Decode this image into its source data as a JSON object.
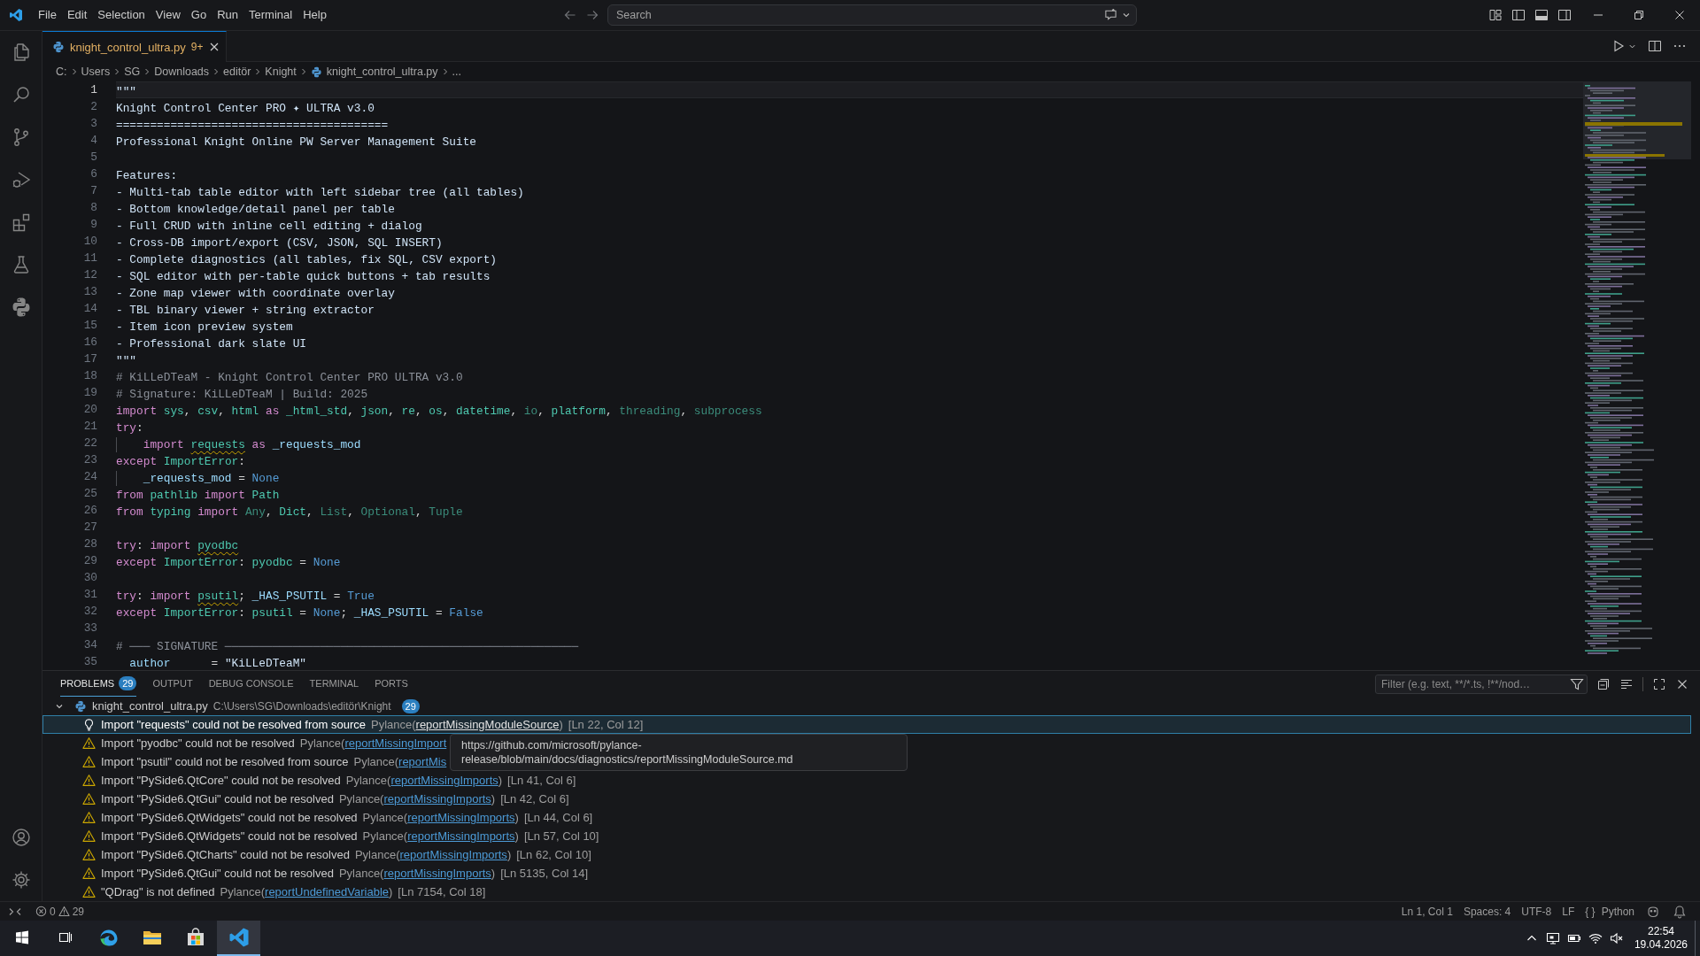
{
  "title_bar": {
    "menu": [
      "File",
      "Edit",
      "Selection",
      "View",
      "Go",
      "Run",
      "Terminal",
      "Help"
    ],
    "search": {
      "placeholder": "Search"
    }
  },
  "editor": {
    "tabs": [
      {
        "label": "knight_control_ultra.py",
        "badge": "9+",
        "selected": true
      }
    ],
    "breadcrumb": [
      {
        "label": "C:",
        "kind": "segment"
      },
      {
        "label": "Users",
        "kind": "segment"
      },
      {
        "label": "SG",
        "kind": "segment"
      },
      {
        "label": "Downloads",
        "kind": "segment"
      },
      {
        "label": "editör",
        "kind": "segment"
      },
      {
        "label": "Knight",
        "kind": "segment"
      },
      {
        "label": "knight_control_ultra.py",
        "kind": "file"
      },
      {
        "label": "...",
        "kind": "segment"
      }
    ],
    "lines": [
      {
        "n": "1",
        "current": true,
        "tokens": [
          {
            "t": "\"\"\"",
            "kind": "string"
          }
        ]
      },
      {
        "n": "2",
        "current": false,
        "tokens": [
          {
            "t": "Knight Control Center PRO ✦ ULTRA v3.0",
            "kind": "string"
          }
        ]
      },
      {
        "n": "3",
        "current": false,
        "tokens": [
          {
            "t": "========================================",
            "kind": "string"
          }
        ]
      },
      {
        "n": "4",
        "current": false,
        "tokens": [
          {
            "t": "Professional Knight Online PW Server Management Suite",
            "kind": "string"
          }
        ]
      },
      {
        "n": "5",
        "current": false
      },
      {
        "n": "6",
        "current": false,
        "tokens": [
          {
            "t": "Features:",
            "kind": "string"
          }
        ]
      },
      {
        "n": "7",
        "current": false,
        "tokens": [
          {
            "t": "- Multi-tab table editor with left sidebar tree (all tables)",
            "kind": "string"
          }
        ]
      },
      {
        "n": "8",
        "current": false,
        "tokens": [
          {
            "t": "- Bottom knowledge/detail panel per table",
            "kind": "string"
          }
        ]
      },
      {
        "n": "9",
        "current": false,
        "tokens": [
          {
            "t": "- Full CRUD with inline cell editing + dialog",
            "kind": "string"
          }
        ]
      },
      {
        "n": "10",
        "current": false,
        "tokens": [
          {
            "t": "- Cross-DB import/export (CSV, JSON, SQL INSERT)",
            "kind": "string"
          }
        ]
      },
      {
        "n": "11",
        "current": false,
        "tokens": [
          {
            "t": "- Complete diagnostics (all tables, fix SQL, CSV export)",
            "kind": "string"
          }
        ]
      },
      {
        "n": "12",
        "current": false,
        "tokens": [
          {
            "t": "- SQL editor with per-table quick buttons + tab results",
            "kind": "string"
          }
        ]
      },
      {
        "n": "13",
        "current": false,
        "tokens": [
          {
            "t": "- Zone map viewer with coordinate overlay",
            "kind": "string"
          }
        ]
      },
      {
        "n": "14",
        "current": false,
        "tokens": [
          {
            "t": "- TBL binary viewer + string extractor",
            "kind": "string"
          }
        ]
      },
      {
        "n": "15",
        "current": false,
        "tokens": [
          {
            "t": "- Item icon preview system",
            "kind": "string"
          }
        ]
      },
      {
        "n": "16",
        "current": false,
        "tokens": [
          {
            "t": "- Professional dark slate UI",
            "kind": "string"
          }
        ]
      },
      {
        "n": "17",
        "current": false,
        "tokens": [
          {
            "t": "\"\"\"",
            "kind": "string"
          }
        ]
      },
      {
        "n": "18",
        "current": false,
        "tokens": [
          {
            "t": "# KiLLeDTeaM - Knight Control Center PRO ULTRA v3.0",
            "kind": "comment"
          }
        ]
      },
      {
        "n": "19",
        "current": false,
        "tokens": [
          {
            "t": "# Signature: KiLLeDTeaM | Build: 2025",
            "kind": "comment"
          }
        ]
      },
      {
        "n": "20",
        "current": false,
        "tokens": [
          {
            "t": "import ",
            "kind": "keyword"
          },
          {
            "t": "sys",
            "kind": "module"
          },
          {
            "t": ", ",
            "kind": "plain"
          },
          {
            "t": "csv",
            "kind": "module"
          },
          {
            "t": ", ",
            "kind": "plain"
          },
          {
            "t": "html",
            "kind": "module"
          },
          {
            "t": " as ",
            "kind": "keyword"
          },
          {
            "t": "_html_std",
            "kind": "module"
          },
          {
            "t": ", ",
            "kind": "plain"
          },
          {
            "t": "json",
            "kind": "module"
          },
          {
            "t": ", ",
            "kind": "plain"
          },
          {
            "t": "re",
            "kind": "module"
          },
          {
            "t": ", ",
            "kind": "plain"
          },
          {
            "t": "os",
            "kind": "module"
          },
          {
            "t": ", ",
            "kind": "plain"
          },
          {
            "t": "datetime",
            "kind": "module"
          },
          {
            "t": ", ",
            "kind": "plain"
          },
          {
            "t": "io",
            "kind": "unused"
          },
          {
            "t": ", ",
            "kind": "plain"
          },
          {
            "t": "platform",
            "kind": "module"
          },
          {
            "t": ", ",
            "kind": "plain"
          },
          {
            "t": "threading",
            "kind": "unused"
          },
          {
            "t": ", ",
            "kind": "plain"
          },
          {
            "t": "subprocess",
            "kind": "unused"
          }
        ]
      },
      {
        "n": "21",
        "current": false,
        "tokens": [
          {
            "t": "try",
            "kind": "keyword"
          },
          {
            "t": ":",
            "kind": "plain"
          }
        ]
      },
      {
        "n": "22",
        "current": false,
        "indent_guide": true,
        "tokens": [
          {
            "t": "    import ",
            "kind": "keyword"
          },
          {
            "t": "requests",
            "kind": "unresolved"
          },
          {
            "t": " as ",
            "kind": "keyword"
          },
          {
            "t": "_requests_mod",
            "kind": "variable"
          }
        ]
      },
      {
        "n": "23",
        "current": false,
        "tokens": [
          {
            "t": "except ",
            "kind": "keyword"
          },
          {
            "t": "ImportError",
            "kind": "module"
          },
          {
            "t": ":",
            "kind": "plain"
          }
        ]
      },
      {
        "n": "24",
        "current": false,
        "indent_guide": true,
        "tokens": [
          {
            "t": "    _requests_mod",
            "kind": "variable"
          },
          {
            "t": " = ",
            "kind": "plain"
          },
          {
            "t": "None",
            "kind": "constant"
          }
        ]
      },
      {
        "n": "25",
        "current": false,
        "tokens": [
          {
            "t": "from ",
            "kind": "keyword"
          },
          {
            "t": "pathlib",
            "kind": "module"
          },
          {
            "t": " import ",
            "kind": "keyword"
          },
          {
            "t": "Path",
            "kind": "module"
          }
        ]
      },
      {
        "n": "26",
        "current": false,
        "tokens": [
          {
            "t": "from ",
            "kind": "keyword"
          },
          {
            "t": "typing",
            "kind": "module"
          },
          {
            "t": " import ",
            "kind": "keyword"
          },
          {
            "t": "Any",
            "kind": "unused"
          },
          {
            "t": ", ",
            "kind": "plain"
          },
          {
            "t": "Dict",
            "kind": "module"
          },
          {
            "t": ", ",
            "kind": "plain"
          },
          {
            "t": "List",
            "kind": "unused"
          },
          {
            "t": ", ",
            "kind": "plain"
          },
          {
            "t": "Optional",
            "kind": "unused"
          },
          {
            "t": ", ",
            "kind": "plain"
          },
          {
            "t": "Tuple",
            "kind": "unused"
          }
        ]
      },
      {
        "n": "27",
        "current": false
      },
      {
        "n": "28",
        "current": false,
        "tokens": [
          {
            "t": "try",
            "kind": "keyword"
          },
          {
            "t": ": ",
            "kind": "plain"
          },
          {
            "t": "import ",
            "kind": "keyword"
          },
          {
            "t": "pyodbc",
            "kind": "unresolved"
          }
        ]
      },
      {
        "n": "29",
        "current": false,
        "tokens": [
          {
            "t": "except ",
            "kind": "keyword"
          },
          {
            "t": "ImportError",
            "kind": "module"
          },
          {
            "t": ": ",
            "kind": "plain"
          },
          {
            "t": "pyodbc",
            "kind": "module"
          },
          {
            "t": " = ",
            "kind": "plain"
          },
          {
            "t": "None",
            "kind": "constant"
          }
        ]
      },
      {
        "n": "30",
        "current": false
      },
      {
        "n": "31",
        "current": false,
        "tokens": [
          {
            "t": "try",
            "kind": "keyword"
          },
          {
            "t": ": ",
            "kind": "plain"
          },
          {
            "t": "import ",
            "kind": "keyword"
          },
          {
            "t": "psutil",
            "kind": "unresolved"
          },
          {
            "t": "; ",
            "kind": "plain"
          },
          {
            "t": "_HAS_PSUTIL",
            "kind": "variable"
          },
          {
            "t": " = ",
            "kind": "plain"
          },
          {
            "t": "True",
            "kind": "constant"
          }
        ]
      },
      {
        "n": "32",
        "current": false,
        "tokens": [
          {
            "t": "except ",
            "kind": "keyword"
          },
          {
            "t": "ImportError",
            "kind": "module"
          },
          {
            "t": ": ",
            "kind": "plain"
          },
          {
            "t": "psutil",
            "kind": "module"
          },
          {
            "t": " = ",
            "kind": "plain"
          },
          {
            "t": "None",
            "kind": "constant"
          },
          {
            "t": "; ",
            "kind": "plain"
          },
          {
            "t": "_HAS_PSUTIL",
            "kind": "variable"
          },
          {
            "t": " = ",
            "kind": "plain"
          },
          {
            "t": "False",
            "kind": "constant"
          }
        ]
      },
      {
        "n": "33",
        "current": false
      },
      {
        "n": "34",
        "current": false,
        "tokens": [
          {
            "t": "# ─── SIGNATURE ────────────────────────────────────────────────────",
            "kind": "comment"
          }
        ]
      },
      {
        "n": "35",
        "current": false,
        "tokens": [
          {
            "t": "  author",
            "kind": "variable"
          },
          {
            "t": "      = ",
            "kind": "plain"
          },
          {
            "t": "\"KiLLeDTeaM\"",
            "kind": "string"
          }
        ]
      }
    ]
  },
  "panel": {
    "tabs": [
      {
        "label": "PROBLEMS",
        "badge": "29",
        "selected": true
      },
      {
        "label": "OUTPUT",
        "selected": false
      },
      {
        "label": "DEBUG CONSOLE",
        "selected": false
      },
      {
        "label": "TERMINAL",
        "selected": false
      },
      {
        "label": "PORTS",
        "selected": false
      }
    ],
    "filter": {
      "placeholder": "Filter (e.g. text, **/*.ts, !**/nod…"
    },
    "problems": {
      "file": {
        "name": "knight_control_ultra.py",
        "path": "C:\\Users\\SG\\Downloads\\editör\\Knight",
        "count": "29",
        "expanded": true
      },
      "rows": [
        {
          "message": "Import \"requests\" could not be resolved from source",
          "source": "Pylance(",
          "code": "reportMissingModuleSource",
          "source_end": ")",
          "location": "[Ln 22, Col 12]",
          "selected": true
        },
        {
          "message": "Import \"pyodbc\" could not be resolved",
          "source": "Pylance(",
          "code": "reportMissingImport",
          "selected": false
        },
        {
          "message": "Import \"psutil\" could not be resolved from source",
          "source": "Pylance(",
          "code": "reportMis",
          "selected": false
        },
        {
          "message": "Import \"PySide6.QtCore\" could not be resolved",
          "source": "Pylance(",
          "code": "reportMissingImports",
          "source_end": ")",
          "location": "[Ln 41, Col 6]",
          "selected": false
        },
        {
          "message": "Import \"PySide6.QtGui\" could not be resolved",
          "source": "Pylance(",
          "code": "reportMissingImports",
          "source_end": ")",
          "location": "[Ln 42, Col 6]",
          "selected": false
        },
        {
          "message": "Import \"PySide6.QtWidgets\" could not be resolved",
          "source": "Pylance(",
          "code": "reportMissingImports",
          "source_end": ")",
          "location": "[Ln 44, Col 6]",
          "selected": false
        },
        {
          "message": "Import \"PySide6.QtWidgets\" could not be resolved",
          "source": "Pylance(",
          "code": "reportMissingImports",
          "source_end": ")",
          "location": "[Ln 57, Col 10]",
          "selected": false
        },
        {
          "message": "Import \"PySide6.QtCharts\" could not be resolved",
          "source": "Pylance(",
          "code": "reportMissingImports",
          "source_end": ")",
          "location": "[Ln 62, Col 10]",
          "selected": false
        },
        {
          "message": "Import \"PySide6.QtGui\" could not be resolved",
          "source": "Pylance(",
          "code": "reportMissingImports",
          "source_end": ")",
          "location": "[Ln 5135, Col 14]",
          "selected": false
        },
        {
          "message": "\"QDrag\" is not defined",
          "source": "Pylance(",
          "code": "reportUndefinedVariable",
          "source_end": ")",
          "location": "[Ln 7154, Col 18]",
          "selected": false
        }
      ]
    },
    "tooltip": {
      "lines": [
        "https://github.com/microsoft/pylance-",
        "release/blob/main/docs/diagnostics/reportMissingModuleSource.md"
      ]
    }
  },
  "status_bar": {
    "errors": "0",
    "warnings": "29",
    "items": [
      "Ln 1, Col 1",
      "Spaces: 4",
      "UTF-8",
      "LF"
    ],
    "language": {
      "glyph": "{ }",
      "label": "Python"
    }
  },
  "taskbar": {
    "apps": [
      {
        "kind": "browser",
        "selected": false
      },
      {
        "kind": "files",
        "selected": false
      },
      {
        "kind": "store",
        "selected": false
      },
      {
        "kind": "editor",
        "selected": true
      }
    ],
    "time": "22:54",
    "date": "19.04.2026"
  }
}
